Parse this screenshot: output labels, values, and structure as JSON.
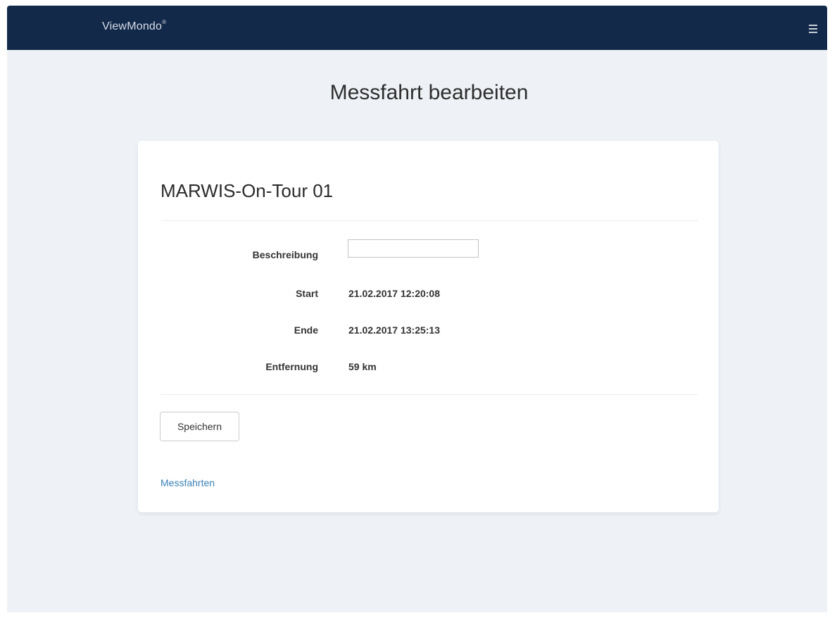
{
  "navbar": {
    "brand": "ViewMondo",
    "brand_mark": "®",
    "menu_icon": "hamburger-menu-icon"
  },
  "page": {
    "title": "Messfahrt bearbeiten"
  },
  "card": {
    "title": "MARWIS-On-Tour 01",
    "fields": {
      "description": {
        "label": "Beschreibung",
        "value": "",
        "placeholder": ""
      },
      "start": {
        "label": "Start",
        "value": "21.02.2017 12:20:08"
      },
      "end": {
        "label": "Ende",
        "value": "21.02.2017 13:25:13"
      },
      "distance": {
        "label": "Entfernung",
        "value": "59 km"
      }
    },
    "save_label": "Speichern",
    "back_link": "Messfahrten"
  },
  "colors": {
    "navbar_bg": "#13294a",
    "page_bg": "#eef2f6",
    "link": "#3b82b6"
  }
}
